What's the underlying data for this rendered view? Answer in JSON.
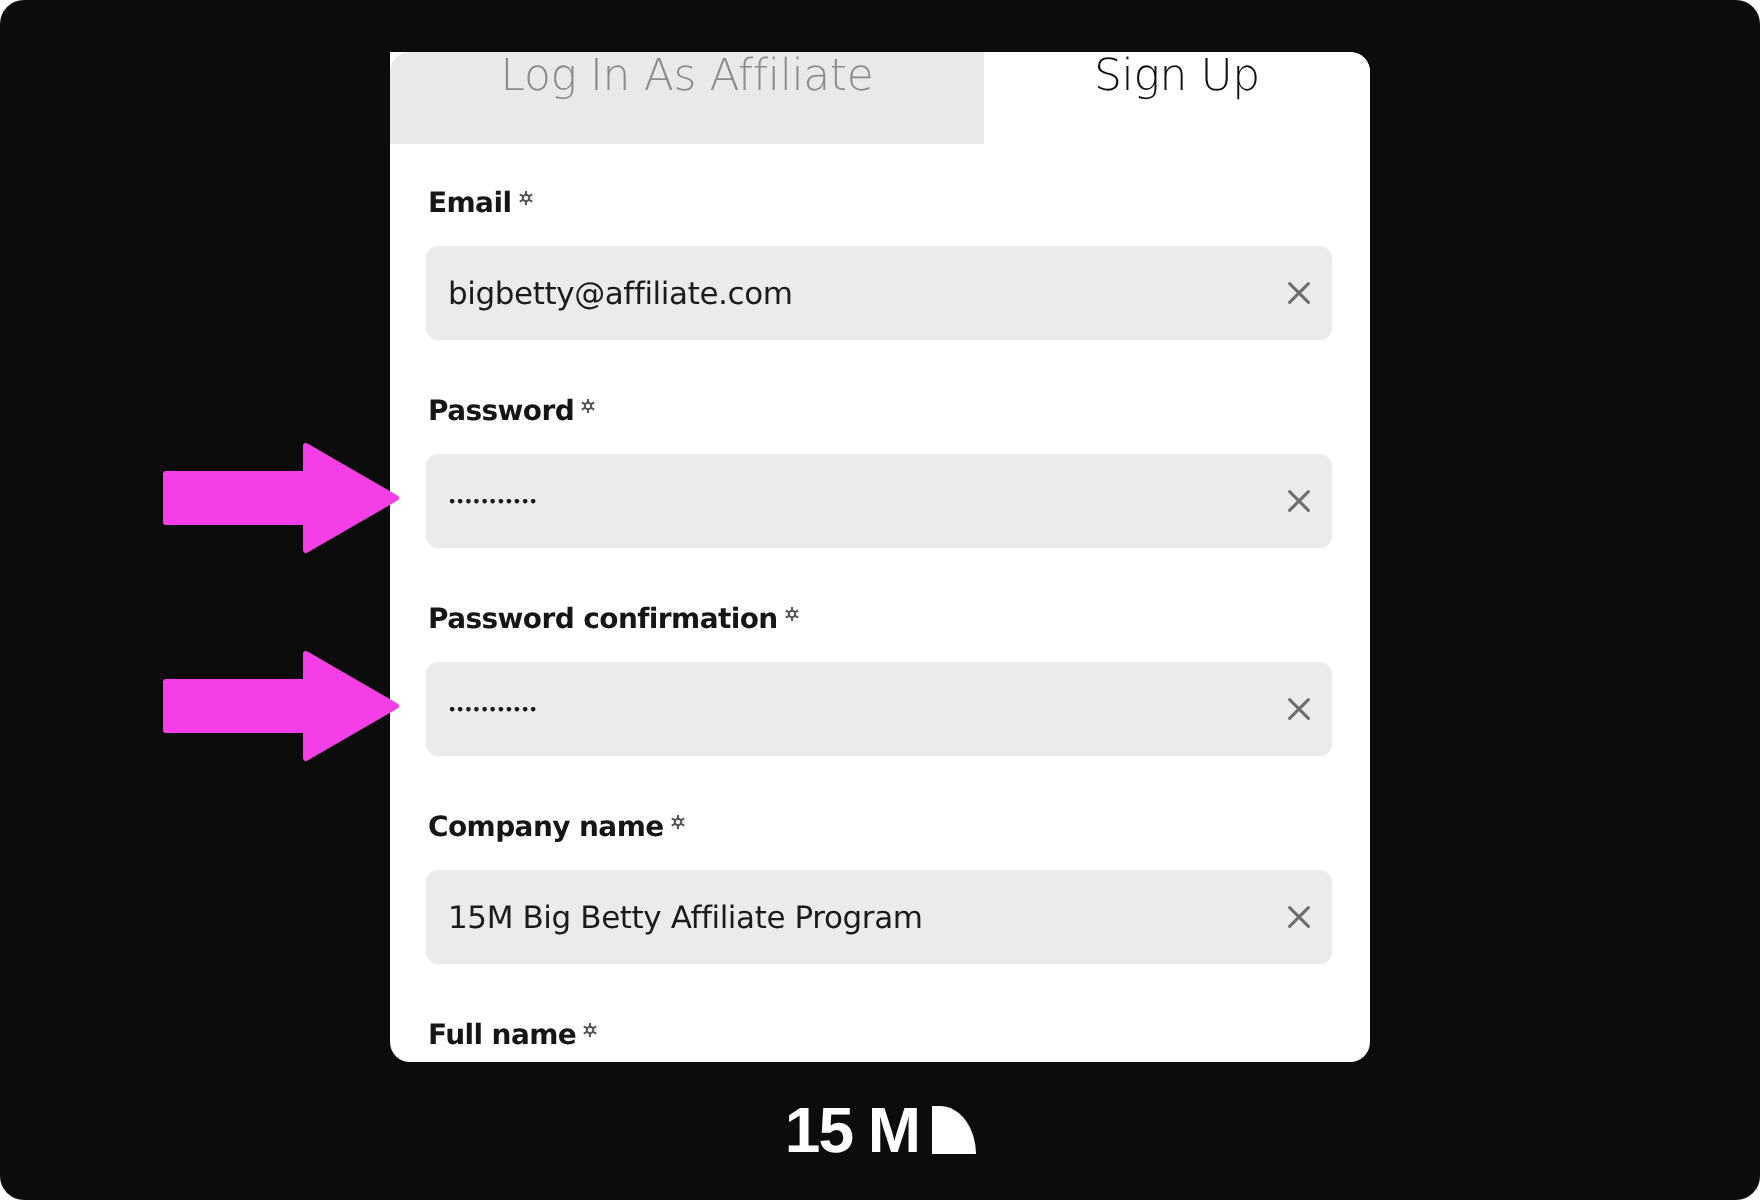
{
  "tabs": [
    {
      "label": "Log In As Affiliate",
      "selected": false
    },
    {
      "label": "Sign Up",
      "selected": true
    }
  ],
  "fields": [
    {
      "label": "Email",
      "required": true,
      "kind": "text",
      "value": "bigbetty@affiliate.com",
      "marked": false
    },
    {
      "label": "Password",
      "required": true,
      "kind": "password",
      "value": "•••••••••••",
      "marked": true
    },
    {
      "label": "Password confirmation",
      "required": true,
      "kind": "password",
      "value": "•••••••••••",
      "marked": true
    },
    {
      "label": "Company name",
      "required": true,
      "kind": "text",
      "value": "15M Big Betty Affiliate Program",
      "marked": false
    },
    {
      "label": "Full name",
      "required": true,
      "marked": false
    }
  ],
  "footer": {
    "logo": "15 M"
  }
}
